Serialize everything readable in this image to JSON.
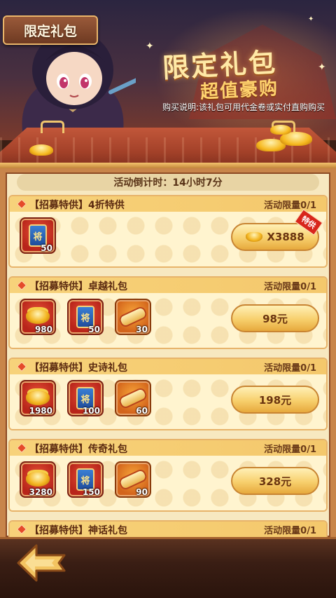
{
  "header": {
    "title": "限定礼包",
    "headline": "限定礼包",
    "subheadline": "超值豪购",
    "purchase_note": "购买说明:该礼包可用代金卷或实付直购购买"
  },
  "countdown": {
    "text": "活动倒计时：14小时7分"
  },
  "packs": [
    {
      "title": "【招募特供】4折特供",
      "limit": "活动限量0/1",
      "items": [
        {
          "icon": "general-token-icon",
          "count": "50"
        }
      ],
      "price": "X3888",
      "price_type": "gold-ingot",
      "tag": "特供"
    },
    {
      "title": "【招募特供】卓越礼包",
      "limit": "活动限量0/1",
      "items": [
        {
          "icon": "gold-ingot-icon",
          "count": "980"
        },
        {
          "icon": "general-token-icon",
          "count": "50"
        },
        {
          "icon": "recruit-scroll-icon",
          "count": "30"
        }
      ],
      "price": "98元"
    },
    {
      "title": "【招募特供】史诗礼包",
      "limit": "活动限量0/1",
      "items": [
        {
          "icon": "gold-ingot-icon",
          "count": "1980"
        },
        {
          "icon": "general-token-icon",
          "count": "100"
        },
        {
          "icon": "recruit-scroll-icon",
          "count": "60"
        }
      ],
      "price": "198元"
    },
    {
      "title": "【招募特供】传奇礼包",
      "limit": "活动限量0/1",
      "items": [
        {
          "icon": "gold-ingot-icon",
          "count": "3280"
        },
        {
          "icon": "general-token-icon",
          "count": "150"
        },
        {
          "icon": "recruit-scroll-icon",
          "count": "90"
        }
      ],
      "price": "328元"
    },
    {
      "title": "【招募特供】神话礼包",
      "limit": "活动限量0/1"
    }
  ],
  "token_glyph": "将",
  "colors": {
    "accent": "#f7cf6c",
    "card_bg": "#fff4cf",
    "frame": "#c8854a",
    "roof": "#a34129"
  }
}
